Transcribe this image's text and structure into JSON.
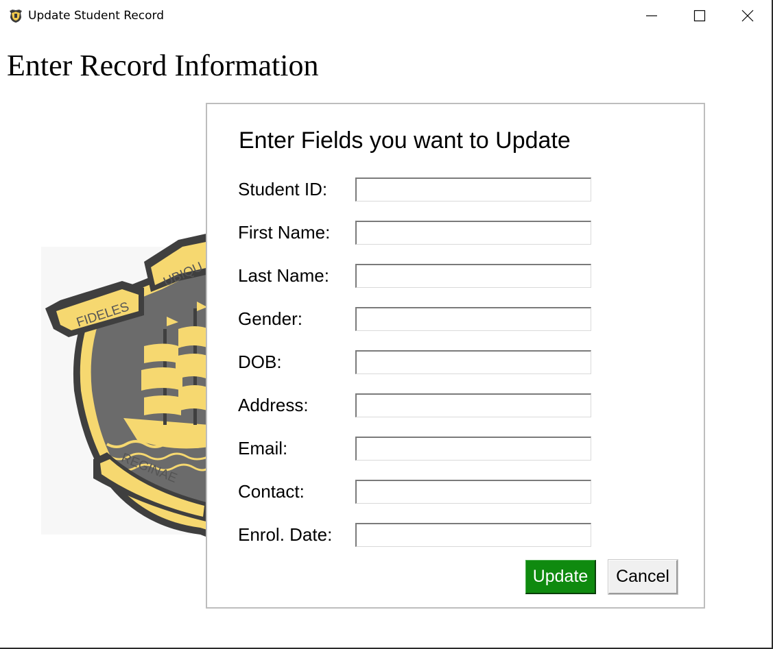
{
  "window": {
    "title": "Update Student Record",
    "icon": "school-crest-icon",
    "controls": [
      "minimize-icon",
      "maximize-icon",
      "close-icon"
    ]
  },
  "heading": "Enter Record Information",
  "crest": {
    "motto_left": "FIDELES",
    "motto_top": "UBIQU",
    "motto_bottom": "REGINAE",
    "colors": {
      "shield": "#6b6b6b",
      "gold": "#f6d870",
      "outline": "#3a3a3a"
    }
  },
  "form": {
    "title": "Enter Fields you want to Update",
    "fields": [
      {
        "label": "Student ID:",
        "value": ""
      },
      {
        "label": "First Name:",
        "value": ""
      },
      {
        "label": "Last Name:",
        "value": ""
      },
      {
        "label": "Gender:",
        "value": ""
      },
      {
        "label": "DOB:",
        "value": ""
      },
      {
        "label": "Address:",
        "value": ""
      },
      {
        "label": "Email:",
        "value": ""
      },
      {
        "label": "Contact:",
        "value": ""
      },
      {
        "label": "Enrol. Date:",
        "value": ""
      }
    ],
    "update_label": "Update",
    "cancel_label": "Cancel",
    "colors": {
      "update_bg": "#0f8a0f",
      "cancel_bg": "#f0f0f0"
    }
  }
}
